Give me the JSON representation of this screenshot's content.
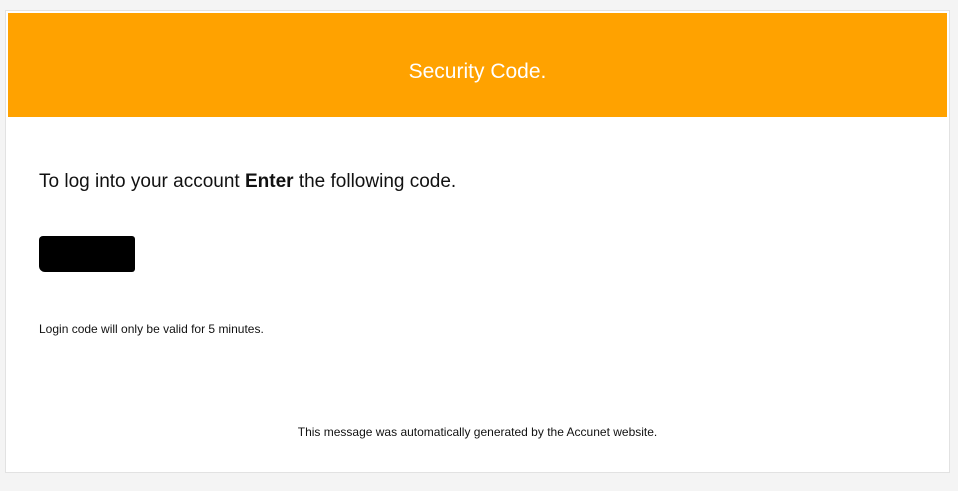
{
  "colors": {
    "page_background": "#f4f4f4",
    "header_background": "#ffa200",
    "header_text": "#ffffff",
    "body_text": "#111111",
    "redaction": "#000000"
  },
  "header": {
    "title": "Security Code."
  },
  "message": {
    "intro_before": "To log into your account ",
    "intro_emphasis": "Enter",
    "intro_after": " the following code.",
    "validity": "Login code will only be valid for 5 minutes.",
    "footer": "This message was automatically generated by the Accunet website."
  }
}
